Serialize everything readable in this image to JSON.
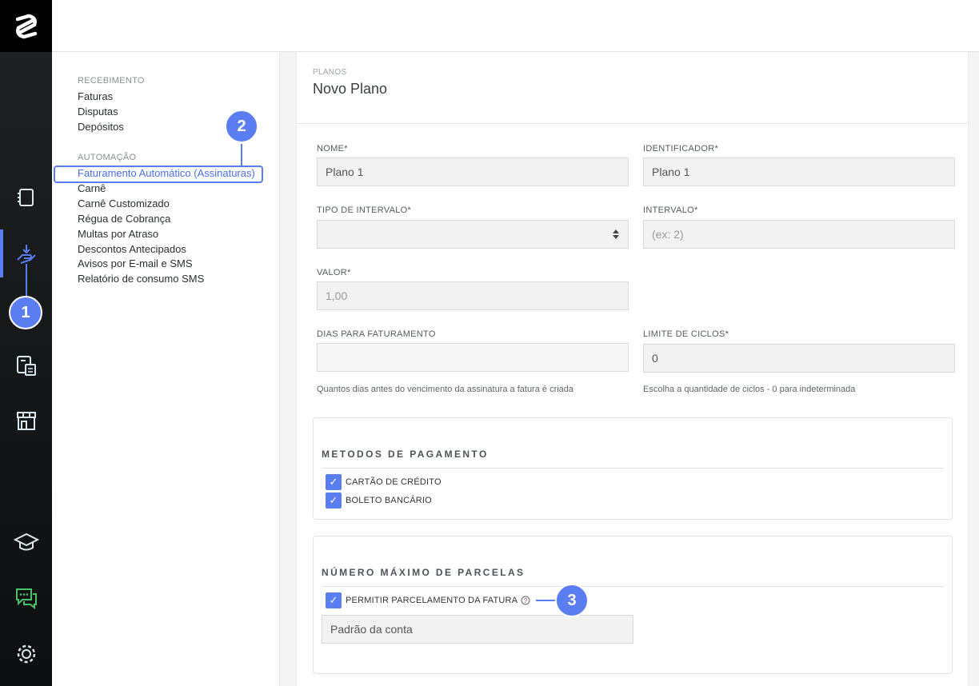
{
  "submenu": {
    "recebimento": {
      "title": "RECEBIMENTO",
      "items": [
        "Faturas",
        "Disputas",
        "Depósitos"
      ]
    },
    "automacao": {
      "title": "AUTOMAÇÃO",
      "items": [
        "Faturamento Automático (Assinaturas)",
        "Carnê",
        "Carnê Customizado",
        "Régua de Cobrança",
        "Multas por Atraso",
        "Descontos Antecipados",
        "Avisos por E-mail e SMS",
        "Relatório de consumo SMS"
      ]
    }
  },
  "page": {
    "breadcrumb": "PLANOS",
    "title": "Novo Plano"
  },
  "form": {
    "nome": {
      "label": "NOME*",
      "value": "Plano 1"
    },
    "identificador": {
      "label": "IDENTIFICADOR*",
      "value": "Plano 1"
    },
    "tipo_intervalo": {
      "label": "TIPO DE INTERVALO*",
      "value": ""
    },
    "intervalo": {
      "label": "INTERVALO*",
      "placeholder": "(ex: 2)"
    },
    "valor": {
      "label": "VALOR*",
      "placeholder": "1,00"
    },
    "dias": {
      "label": "DIAS PARA FATURAMENTO",
      "help": "Quantos dias antes do vencimento da assinatura a fatura é criada"
    },
    "limite": {
      "label": "LIMITE DE CICLOS*",
      "value": "0",
      "help": "Escolha a quantidade de ciclos - 0 para indeterminada"
    }
  },
  "metodos": {
    "title": "METODOS DE PAGAMENTO",
    "options": [
      {
        "label": "CARTÃO DE CRÉDITO",
        "checked": true
      },
      {
        "label": "BOLETO BANCÁRIO",
        "checked": true
      }
    ]
  },
  "parcelas": {
    "title": "NÚMERO MÁXIMO DE PARCELAS",
    "allow_label": "PERMITIR PARCELAMENTO DA FATURA",
    "allow_checked": true,
    "select_value": "Padrão da conta"
  },
  "callouts": [
    "1",
    "2",
    "3"
  ],
  "colors": {
    "accent": "#5a7ef2",
    "rail": "#1a1d1f"
  }
}
